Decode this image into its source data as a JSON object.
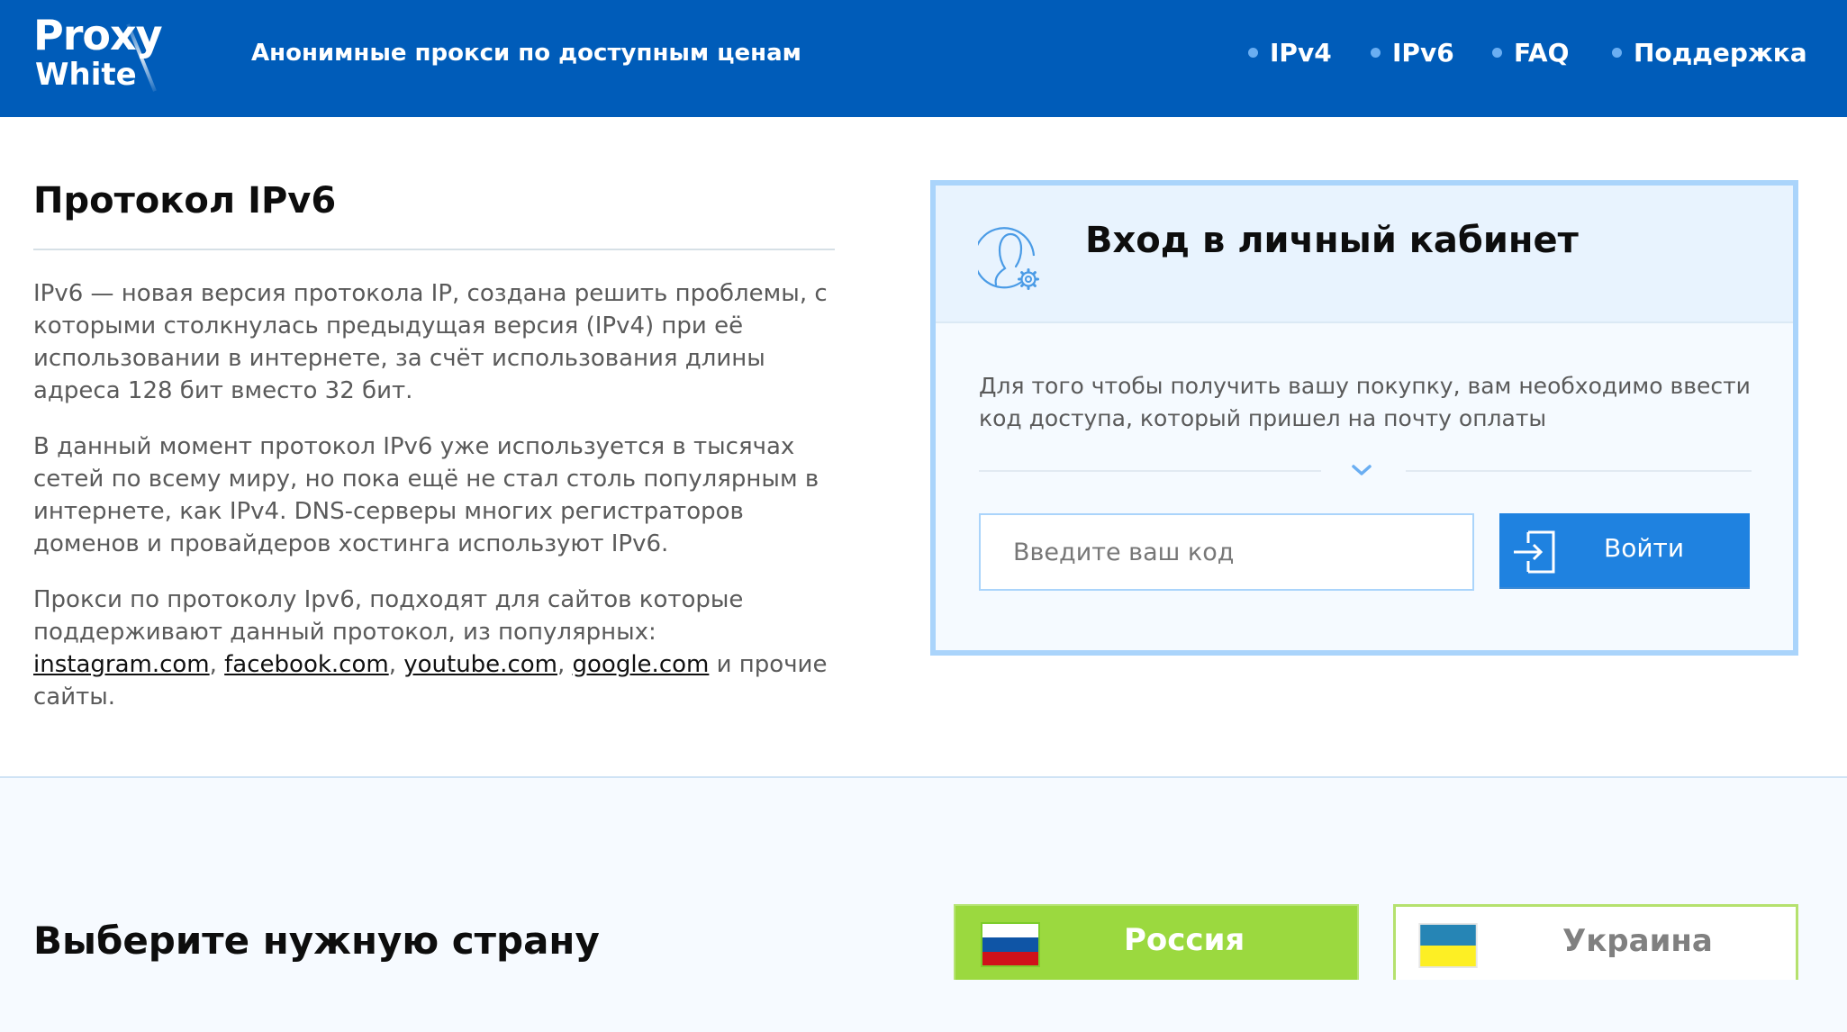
{
  "header": {
    "logo_line1": "Proxy",
    "logo_line2": "White",
    "tagline": "Анонимные прокси по доступным ценам",
    "nav": [
      {
        "label": "IPv4"
      },
      {
        "label": "IPv6"
      },
      {
        "label": "FAQ"
      },
      {
        "label": "Поддержка"
      }
    ]
  },
  "article": {
    "title": "Протокол IPv6",
    "paragraph1": "IPv6 — новая версия протокола IP, создана решить проблемы, с которыми столкнулась предыдущая версия (IPv4) при её использовании в интернете, за счёт использования длины адреса 128 бит вместо 32 бит.",
    "paragraph2": "В данный момент протокол IPv6 уже используется в тысячах сетей по всему миру, но пока ещё не стал столь популярным в интернете, как IPv4. DNS-серверы многих регистраторов доменов и провайдеров хостинга используют IPv6.",
    "paragraph3_intro": "Прокси по протоколу Ipv6, подходят для сайтов которые поддерживают данный протокол, из популярных: ",
    "links": [
      "instagram.com",
      "facebook.com",
      "youtube.com",
      "google.com"
    ],
    "link_separator": ", ",
    "paragraph3_outro": " и прочие сайты."
  },
  "login": {
    "icon": "user-gear-icon",
    "title": "Вход в личный кабинет",
    "description": "Для того чтобы получить вашу покупку, вам необходимо ввести код доступа, который пришел на почту оплаты",
    "input_placeholder": "Введите ваш код",
    "input_value": "",
    "button_label": "Войти",
    "button_icon": "sign-in-icon"
  },
  "countries": {
    "title": "Выберите нужную страну",
    "items": [
      {
        "label": "Россия",
        "flag": "russia-flag",
        "selected": true
      },
      {
        "label": "Украина",
        "flag": "ukraine-flag",
        "selected": false
      }
    ]
  },
  "colors": {
    "header_bg": "#005cb9",
    "accent_blue": "#1f82e0",
    "card_border": "#aad4fb",
    "country_selected": "#9bd93f",
    "country_border": "#b5e16e"
  }
}
